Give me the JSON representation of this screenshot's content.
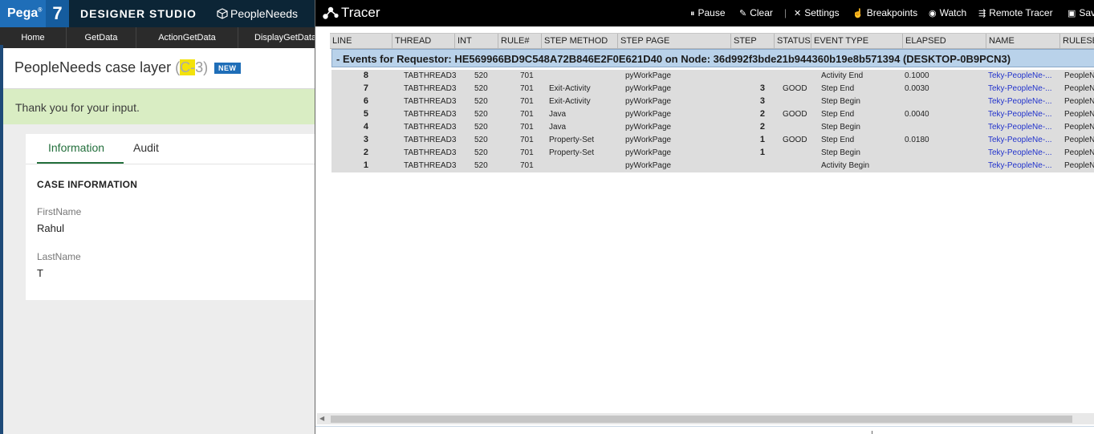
{
  "designer": {
    "brand": "Pega",
    "brand_sup": "®",
    "version": "7",
    "studio_title": "DESIGNER STUDIO",
    "app_name": "PeopleNeeds",
    "tabs": [
      {
        "label": "Home"
      },
      {
        "label": "GetData"
      },
      {
        "label": "ActionGetData"
      },
      {
        "label": "DisplayGetData"
      }
    ],
    "case": {
      "title": "PeopleNeeds case layer",
      "id_open": "(",
      "id_highlight": "C-",
      "id_rest": "3)",
      "badge": "NEW"
    },
    "message": "Thank you for your input.",
    "card_tabs": {
      "information": "Information",
      "audit": "Audit"
    },
    "section_heading": "CASE INFORMATION",
    "fields": [
      {
        "label": "FirstName",
        "value": "Rahul"
      },
      {
        "label": "LastName",
        "value": "T"
      }
    ]
  },
  "tracer": {
    "title": "Tracer",
    "toolbar": {
      "pause": "Pause",
      "clear": "Clear",
      "separator": "|",
      "settings": "Settings",
      "breakpoints": "Breakpoints",
      "watch": "Watch",
      "remote": "Remote Tracer",
      "save": "Sav"
    },
    "columns": [
      "LINE",
      "THREAD",
      "INT",
      "RULE#",
      "STEP METHOD",
      "STEP PAGE",
      "STEP",
      "STATUS",
      "EVENT TYPE",
      "ELAPSED",
      "NAME",
      "RULESE"
    ],
    "group_title": "- Events for Requestor: HE569966BD9C548A72B846E2F0E621D40 on Node: 36d992f3bde21b944360b19e8b571394 (DESKTOP-0B9PCN3)",
    "rows": [
      {
        "line": "8",
        "thread": "TABTHREAD3",
        "int": "520",
        "rule": "701",
        "method": "",
        "page": "pyWorkPage",
        "step": "",
        "status": "",
        "event": "Activity End",
        "elapsed": "0.1000",
        "name": "Teky-PeopleNe-...",
        "ruleset": "PeopleN"
      },
      {
        "line": "7",
        "thread": "TABTHREAD3",
        "int": "520",
        "rule": "701",
        "method": "Exit-Activity",
        "page": "pyWorkPage",
        "step": "3",
        "status": "GOOD",
        "event": "Step End",
        "elapsed": "0.0030",
        "name": "Teky-PeopleNe-...",
        "ruleset": "PeopleN"
      },
      {
        "line": "6",
        "thread": "TABTHREAD3",
        "int": "520",
        "rule": "701",
        "method": "Exit-Activity",
        "page": "pyWorkPage",
        "step": "3",
        "status": "",
        "event": "Step Begin",
        "elapsed": "",
        "name": "Teky-PeopleNe-...",
        "ruleset": "PeopleN"
      },
      {
        "line": "5",
        "thread": "TABTHREAD3",
        "int": "520",
        "rule": "701",
        "method": "Java",
        "page": "pyWorkPage",
        "step": "2",
        "status": "GOOD",
        "event": "Step End",
        "elapsed": "0.0040",
        "name": "Teky-PeopleNe-...",
        "ruleset": "PeopleN"
      },
      {
        "line": "4",
        "thread": "TABTHREAD3",
        "int": "520",
        "rule": "701",
        "method": "Java",
        "page": "pyWorkPage",
        "step": "2",
        "status": "",
        "event": "Step Begin",
        "elapsed": "",
        "name": "Teky-PeopleNe-...",
        "ruleset": "PeopleN"
      },
      {
        "line": "3",
        "thread": "TABTHREAD3",
        "int": "520",
        "rule": "701",
        "method": "Property-Set",
        "page": "pyWorkPage",
        "step": "1",
        "status": "GOOD",
        "event": "Step End",
        "elapsed": "0.0180",
        "name": "Teky-PeopleNe-...",
        "ruleset": "PeopleN"
      },
      {
        "line": "2",
        "thread": "TABTHREAD3",
        "int": "520",
        "rule": "701",
        "method": "Property-Set",
        "page": "pyWorkPage",
        "step": "1",
        "status": "",
        "event": "Step Begin",
        "elapsed": "",
        "name": "Teky-PeopleNe-...",
        "ruleset": "PeopleN"
      },
      {
        "line": "1",
        "thread": "TABTHREAD3",
        "int": "520",
        "rule": "701",
        "method": "",
        "page": "pyWorkPage",
        "step": "",
        "status": "",
        "event": "Activity Begin",
        "elapsed": "",
        "name": "Teky-PeopleNe-...",
        "ruleset": "PeopleN"
      }
    ]
  },
  "colors": {
    "pega_blue": "#1f6eb8",
    "topbar_dark": "#0c2536",
    "success_bg": "#d9edc3",
    "tab_active": "#236f3c",
    "group_row": "#b9d2ea",
    "link_blue": "#2233cc"
  },
  "icons": [
    "cube-icon",
    "tracer-network-icon",
    "pause-icon",
    "eraser-icon",
    "settings-tools-icon",
    "breakpoint-hand-icon",
    "eye-icon",
    "remote-tracer-icon",
    "save-icon",
    "scroll-left-icon"
  ]
}
